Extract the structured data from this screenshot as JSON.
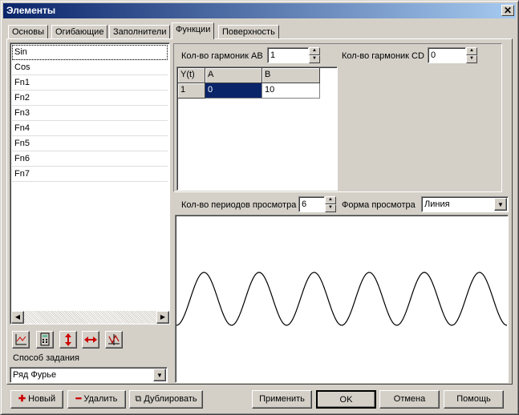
{
  "window": {
    "title": "Элементы"
  },
  "tabs": [
    {
      "label": "Основы"
    },
    {
      "label": "Огибающие"
    },
    {
      "label": "Заполнители"
    },
    {
      "label": "Функции"
    },
    {
      "label": "Поверхность"
    }
  ],
  "functions_list": [
    "Sin",
    "Cos",
    "Fn1",
    "Fn2",
    "Fn3",
    "Fn4",
    "Fn5",
    "Fn6",
    "Fn7"
  ],
  "method": {
    "label": "Способ задания",
    "value": "Ряд Фурье"
  },
  "harmonics": {
    "ab_label": "Кол-во гармоник AB",
    "ab_value": "1",
    "cd_label": "Кол-во гармоник CD",
    "cd_value": "0"
  },
  "grid": {
    "headers": [
      "Y(t)",
      "A",
      "B"
    ],
    "rows": [
      {
        "index": "1",
        "a": "0",
        "b": "10"
      }
    ]
  },
  "preview": {
    "periods_label": "Кол-во периодов просмотра",
    "periods_value": "6",
    "form_label": "Форма просмотра",
    "form_value": "Линия"
  },
  "chart_data": {
    "type": "line",
    "title": "",
    "periods": 6,
    "amplitude": 1,
    "function": "sin"
  },
  "buttons": {
    "new": "Новый",
    "delete": "Удалить",
    "duplicate": "Дублировать",
    "apply": "Применить",
    "ok": "OK",
    "cancel": "Отмена",
    "help": "Помощь"
  },
  "icons": [
    "chart-icon",
    "calculator-icon",
    "vertical-arrows-icon",
    "horizontal-arrows-icon",
    "grid-chart-icon"
  ]
}
